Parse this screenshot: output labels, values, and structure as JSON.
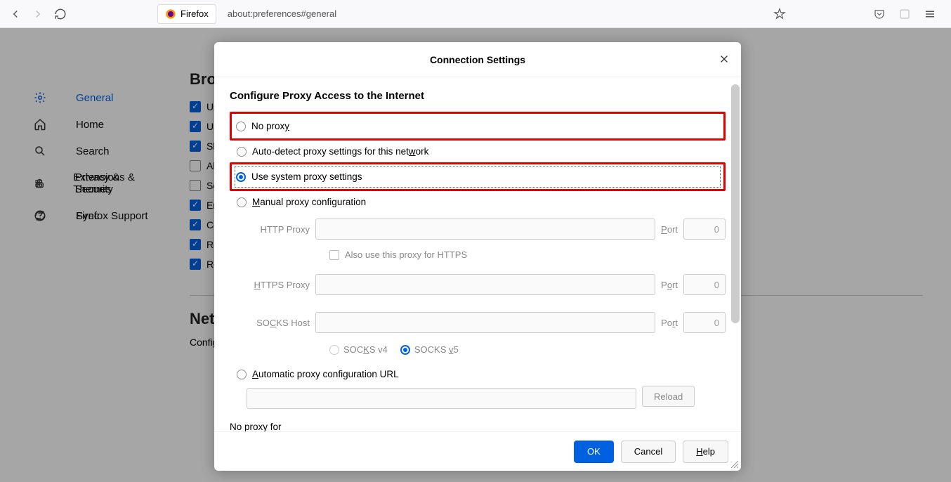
{
  "toolbar": {
    "identity_label": "Firefox",
    "url": "about:preferences#general"
  },
  "sidebar": {
    "items": [
      {
        "label": "General"
      },
      {
        "label": "Home"
      },
      {
        "label": "Search"
      },
      {
        "label": "Privacy & Security"
      },
      {
        "label": "Sync"
      }
    ],
    "bottom": [
      {
        "label": "Extensions & Themes"
      },
      {
        "label": "Firefox Support"
      }
    ]
  },
  "bg": {
    "heading_partial": "Bro",
    "rows": [
      "Us",
      "Us",
      "Sh",
      "Al",
      "Se",
      "En",
      "Co",
      "Re",
      "Re"
    ],
    "net_heading": "Net",
    "net_sub": "Config"
  },
  "modal": {
    "title": "Connection Settings",
    "section_title": "Configure Proxy Access to the Internet",
    "radios": {
      "no_proxy": "No proxy",
      "auto_detect": "Auto-detect proxy settings for this network",
      "system": "Use system proxy settings",
      "manual": "Manual proxy configuration",
      "auto_url": "Automatic proxy configuration URL"
    },
    "proxy": {
      "http_label": "HTTP Proxy",
      "https_label": "HTTPS Proxy",
      "socks_label": "SOCKS Host",
      "port_label": "Port",
      "port_value": "0",
      "also_https": "Also use this proxy for HTTPS",
      "socks_v4": "SOCKS v4",
      "socks_v5": "SOCKS v5"
    },
    "reload": "Reload",
    "no_proxy_for": "No proxy for",
    "buttons": {
      "ok": "OK",
      "cancel": "Cancel",
      "help": "Help"
    }
  }
}
